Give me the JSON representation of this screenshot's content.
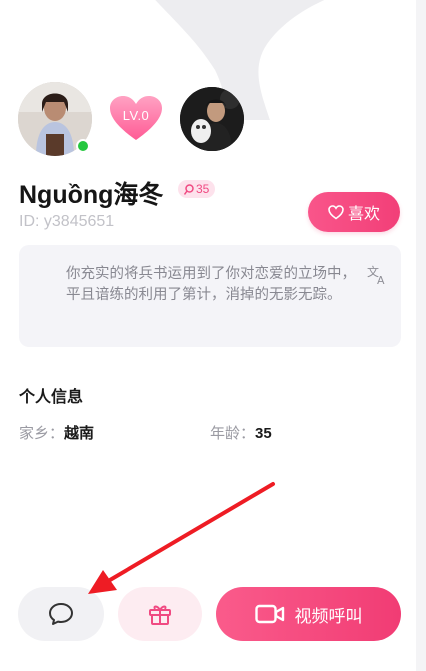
{
  "profile": {
    "name": "Nguồng海冬",
    "likes_count": "35",
    "id_text": "ID: y3845651",
    "level_label": "LV.0",
    "online": true
  },
  "actions": {
    "like_label": "喜欢",
    "video_call_label": "视频呼叫"
  },
  "bio": {
    "text": "你充实的将兵书运用到了你对恋爱的立场中，平且谙练的利用了第计，消掉的无影无踪。"
  },
  "personal_info": {
    "title": "个人信息",
    "hometown_label": "家乡：",
    "hometown_value": "越南",
    "age_label": "年龄：",
    "age_value": "35"
  },
  "colors": {
    "accent": "#f23f78",
    "online": "#25c73e",
    "annotation_arrow": "#ee1c24"
  }
}
